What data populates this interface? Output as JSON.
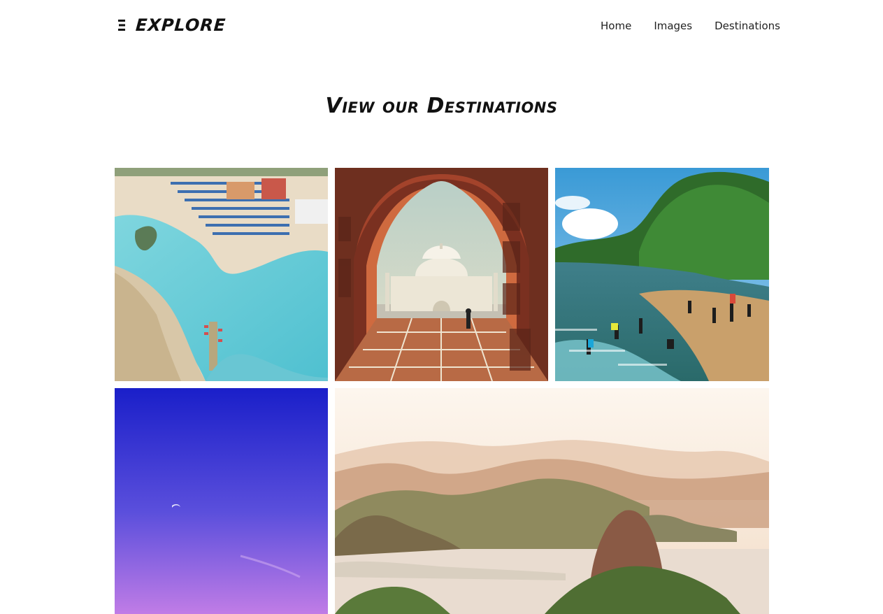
{
  "brand": {
    "name": "EXPLORE",
    "icon": "menu-bars-icon"
  },
  "nav": {
    "items": [
      {
        "label": "Home"
      },
      {
        "label": "Images"
      },
      {
        "label": "Destinations"
      }
    ]
  },
  "section": {
    "title": "View our Destinations"
  },
  "gallery": {
    "tiles": [
      {
        "subject": "beach-aerial"
      },
      {
        "subject": "taj-mahal"
      },
      {
        "subject": "river-bathers"
      },
      {
        "subject": "purple-sky-moon"
      },
      {
        "subject": "rio-mountains"
      }
    ]
  },
  "colors": {
    "text": "#111111",
    "background": "#ffffff"
  }
}
